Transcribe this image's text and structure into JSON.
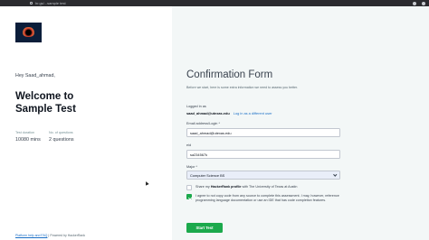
{
  "browser": {
    "url": "hr.gs/...sample test"
  },
  "left": {
    "greeting": "Hey Saad_ahmad,",
    "welcome_line1": "Welcome to",
    "welcome_line2": "Sample Test",
    "meta": [
      {
        "label": "Test duration",
        "value": "10080 mins"
      },
      {
        "label": "No. of questions",
        "value": "2 questions"
      }
    ],
    "footer_help": "Platform help and FAQ",
    "footer_sep": "|",
    "footer_powered": "Powered by HackerRank"
  },
  "form": {
    "title": "Confirmation Form",
    "intro": "Before we start, here is some extra information we need to assess you better.",
    "logged_in_label": "Logged in as",
    "logged_in_email": "saad_ahmad@utexas.edu",
    "login_other": "Log in as a different user",
    "email_label": "Email address/Login *",
    "email_value": "saad_ahmad@utexas.edu",
    "eid_label": "eid",
    "eid_value": "sa234567k",
    "major_label": "Major *",
    "major_value": "Computer Science BS",
    "share_text_pre": "Share my",
    "share_text_bold": "HackerRank profile",
    "share_text_post": "with The University of Texas at Austin",
    "agree_text": "I agree to not copy code from any source to complete this assessment. I may, however, reference programming language documentation or use an IDE that has code completion features.",
    "start_button": "Start Test"
  },
  "checkboxes": {
    "share_checked": false,
    "agree_checked": true
  },
  "colors": {
    "accent_green": "#1ba94c",
    "link_blue": "#1b6fc6",
    "panel_bg": "#f3f7f7"
  }
}
